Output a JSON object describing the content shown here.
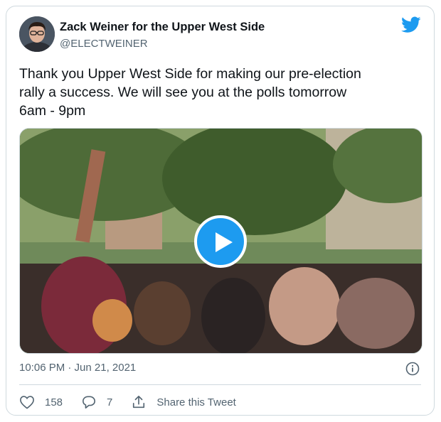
{
  "author": {
    "name": "Zack Weiner for the Upper West Side",
    "handle": "@ELECTWEINER"
  },
  "tweet": {
    "text": "Thank you Upper West Side for making our pre-election\nrally a success. We will see you at the polls tomorrow\n6am - 9pm",
    "timestamp": "10:06 PM · Jun 21, 2021"
  },
  "media": {
    "type": "video",
    "play_icon": "play-icon"
  },
  "actions": {
    "likes": "158",
    "replies": "7",
    "share_label": "Share this Tweet"
  },
  "icons": {
    "brand": "twitter-bird-icon",
    "info": "info-icon",
    "like": "heart-icon",
    "reply": "reply-icon",
    "share": "share-icon"
  },
  "colors": {
    "brand": "#1d9bf0",
    "text": "#0f1419",
    "secondary": "#536471",
    "border": "#cfd9de"
  }
}
